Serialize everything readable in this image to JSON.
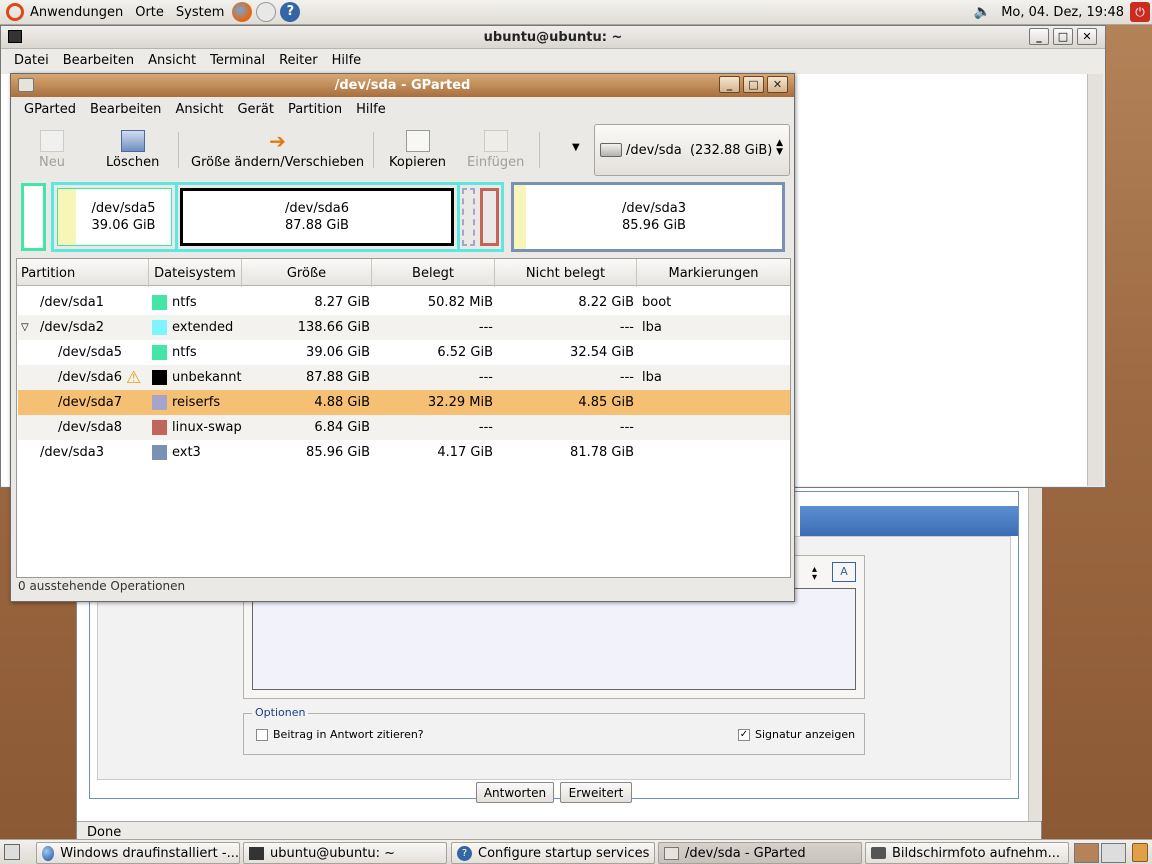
{
  "top_panel": {
    "menus": [
      "Anwendungen",
      "Orte",
      "System"
    ],
    "clock": "Mo, 04. Dez, 19:48"
  },
  "browser": {
    "options_label": "Optionen",
    "quote_checkbox_label": "Beitrag in Antwort zitieren?",
    "signature_checkbox_label": "Signatur anzeigen",
    "reply_button": "Antworten",
    "advanced_button": "Erweitert",
    "status": "Done"
  },
  "terminal": {
    "title": "ubuntu@ubuntu: ~",
    "menu": [
      "Datei",
      "Bearbeiten",
      "Ansicht",
      "Terminal",
      "Reiter",
      "Hilfe"
    ]
  },
  "gparted": {
    "title": "/dev/sda - GParted",
    "menu": [
      "GParted",
      "Bearbeiten",
      "Ansicht",
      "Gerät",
      "Partition",
      "Hilfe"
    ],
    "toolbar": {
      "new": "Neu",
      "delete": "Löschen",
      "resize": "Größe ändern/Verschieben",
      "copy": "Kopieren",
      "paste": "Einfügen"
    },
    "device_selector": "/dev/sda  (232.88 GiB)",
    "partition_blocks": [
      {
        "name": "/dev/sda5",
        "size": "39.06 GiB"
      },
      {
        "name": "/dev/sda6",
        "size": "87.88 GiB"
      },
      {
        "name": "/dev/sda3",
        "size": "85.96 GiB"
      }
    ],
    "columns": [
      "Partition",
      "Dateisystem",
      "Größe",
      "Belegt",
      "Nicht belegt",
      "Markierungen"
    ],
    "rows": [
      {
        "partition": "/dev/sda1",
        "fs": "ntfs",
        "color": "#43e6a6",
        "size": "8.27 GiB",
        "used": "50.82 MiB",
        "unused": "8.22 GiB",
        "flags": "boot"
      },
      {
        "partition": "/dev/sda2",
        "fs": "extended",
        "color": "#7ef4ff",
        "size": "138.66 GiB",
        "used": "---",
        "unused": "---",
        "flags": "lba"
      },
      {
        "partition": "/dev/sda5",
        "fs": "ntfs",
        "color": "#43e6a6",
        "size": "39.06 GiB",
        "used": "6.52 GiB",
        "unused": "32.54 GiB",
        "flags": ""
      },
      {
        "partition": "/dev/sda6",
        "fs": "unbekannt",
        "color": "#000000",
        "size": "87.88 GiB",
        "used": "---",
        "unused": "---",
        "flags": "lba"
      },
      {
        "partition": "/dev/sda7",
        "fs": "reiserfs",
        "color": "#a5a5cc",
        "size": "4.88 GiB",
        "used": "32.29 MiB",
        "unused": "4.85 GiB",
        "flags": ""
      },
      {
        "partition": "/dev/sda8",
        "fs": "linux-swap",
        "color": "#c1665a",
        "size": "6.84 GiB",
        "used": "---",
        "unused": "---",
        "flags": ""
      },
      {
        "partition": "/dev/sda3",
        "fs": "ext3",
        "color": "#7891b5",
        "size": "85.96 GiB",
        "used": "4.17 GiB",
        "unused": "81.78 GiB",
        "flags": ""
      }
    ],
    "status": "0 ausstehende Operationen"
  },
  "taskbar": [
    "Windows draufinstalliert -...",
    "ubuntu@ubuntu: ~",
    "Configure startup services",
    "/dev/sda - GParted",
    "Bildschirmfoto aufnehm..."
  ]
}
